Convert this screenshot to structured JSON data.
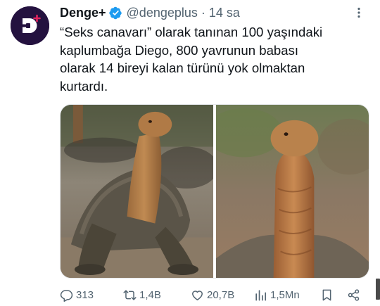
{
  "tweet": {
    "display_name": "Denge+",
    "handle": "@dengeplus",
    "separator": "·",
    "time": "14 sa",
    "text": "“Seks canavarı” olarak tanınan 100 yaşındaki\nkaplumbağa Diego, 800 yavrunun babası\nolarak 14 bireyi kalan türünü yok olmaktan\nkurtardı.",
    "avatar_icon": "denge-plus-logo",
    "verified_icon": "verified-badge-icon",
    "more_icon": "more-dots-icon"
  },
  "media": {
    "images": [
      {
        "icon": "tortoise-photo-full-body"
      },
      {
        "icon": "tortoise-photo-head-closeup"
      }
    ]
  },
  "actions": {
    "reply": {
      "icon": "reply-icon",
      "count": "313"
    },
    "retweet": {
      "icon": "retweet-icon",
      "count": "1,4B"
    },
    "like": {
      "icon": "like-icon",
      "count": "20,7B"
    },
    "views": {
      "icon": "views-icon",
      "count": "1,5Mn"
    },
    "bookmark": {
      "icon": "bookmark-icon"
    },
    "share": {
      "icon": "share-icon"
    }
  },
  "colors": {
    "text": "#0f1419",
    "secondary": "#536471",
    "verified": "#1d9bf0",
    "avatar_bg": "#24123f",
    "avatar_accent": "#e0245e"
  }
}
